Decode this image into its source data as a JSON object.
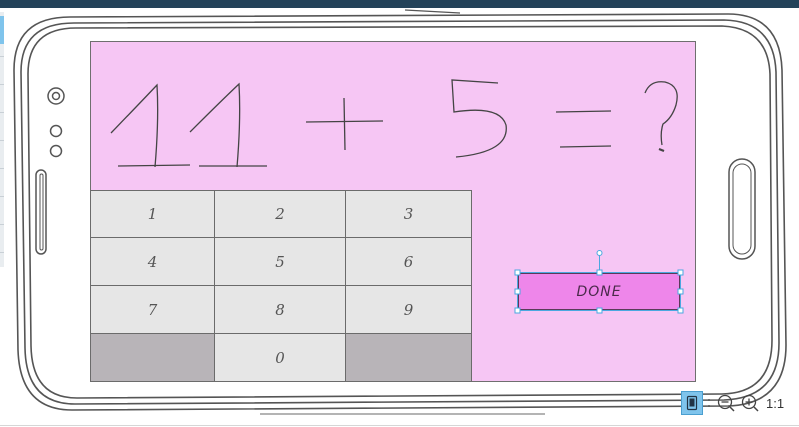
{
  "colors": {
    "screen_bg": "#f6c6f4",
    "key_bg": "#e6e6e6",
    "key_dark_bg": "#b8b4b8",
    "done_bg": "#ee86ea",
    "selection": "#4aa8e0",
    "topbar": "#24435a"
  },
  "equation": {
    "operand1": "11",
    "operator": "+",
    "operand2": "5",
    "equals": "=",
    "unknown": "?"
  },
  "keypad": {
    "keys": [
      "1",
      "2",
      "3",
      "4",
      "5",
      "6",
      "7",
      "8",
      "9",
      "",
      "0",
      ""
    ]
  },
  "done_button": {
    "label": "DONE"
  },
  "zoom_controls": {
    "device_icon": "phone-device-icon",
    "zoom_out_icon": "zoom-out-icon",
    "zoom_in_icon": "zoom-in-icon",
    "ratio_label": "1:1"
  }
}
